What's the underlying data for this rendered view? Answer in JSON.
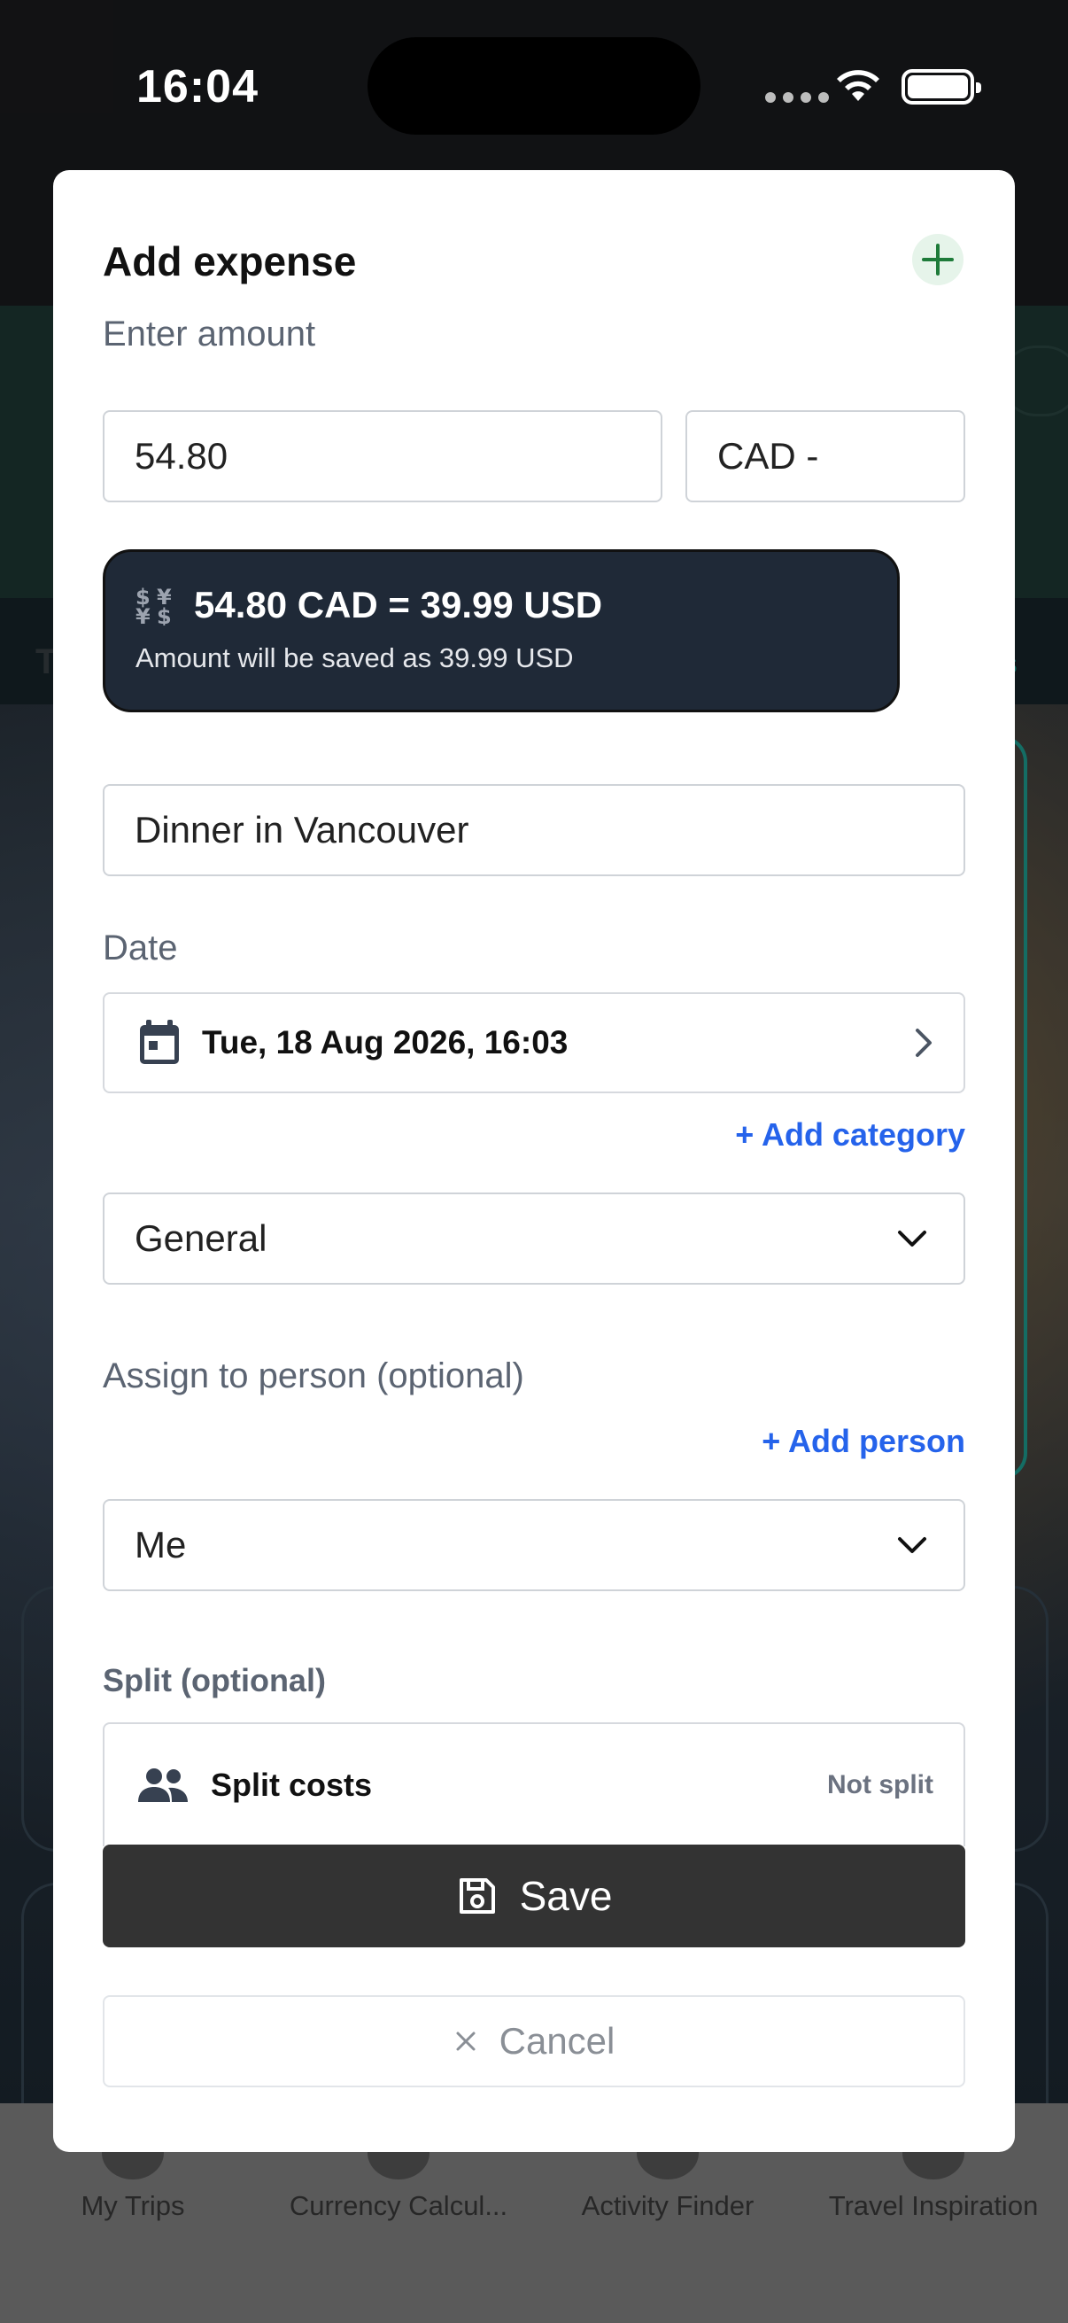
{
  "status_bar": {
    "time": "16:04"
  },
  "modal": {
    "title": "Add expense",
    "amount_label": "Enter amount",
    "amount_value": "54.80",
    "currency_value": "CAD -",
    "conversion": {
      "main": "54.80 CAD = 39.99 USD",
      "sub": "Amount will be saved as 39.99 USD"
    },
    "description_value": "Dinner in Vancouver",
    "date_label": "Date",
    "date_value": "Tue, 18 Aug 2026, 16:03",
    "add_category_label": "+ Add category",
    "category_value": "General",
    "assign_label": "Assign to person (optional)",
    "add_person_label": "+ Add person",
    "person_value": "Me",
    "split_label": "Split (optional)",
    "split_title": "Split costs",
    "split_status": "Not split",
    "save_label": "Save",
    "cancel_label": "Cancel"
  },
  "tabs": [
    {
      "label": "My Trips"
    },
    {
      "label": "Currency Calcul..."
    },
    {
      "label": "Activity Finder"
    },
    {
      "label": "Travel Inspiration"
    }
  ],
  "colors": {
    "accent_link": "#2563eb",
    "plus_icon": "#1e7b3a",
    "save_button": "#333333",
    "conversion_box": "#1f2937"
  },
  "icons": {
    "add": "plus-icon",
    "currency": "currency-exchange-icon",
    "calendar": "calendar-icon",
    "chevron_right": "chevron-right-icon",
    "chevron_down": "chevron-down-icon",
    "people": "people-icon",
    "save": "floppy-disk-icon",
    "cancel": "close-icon"
  }
}
